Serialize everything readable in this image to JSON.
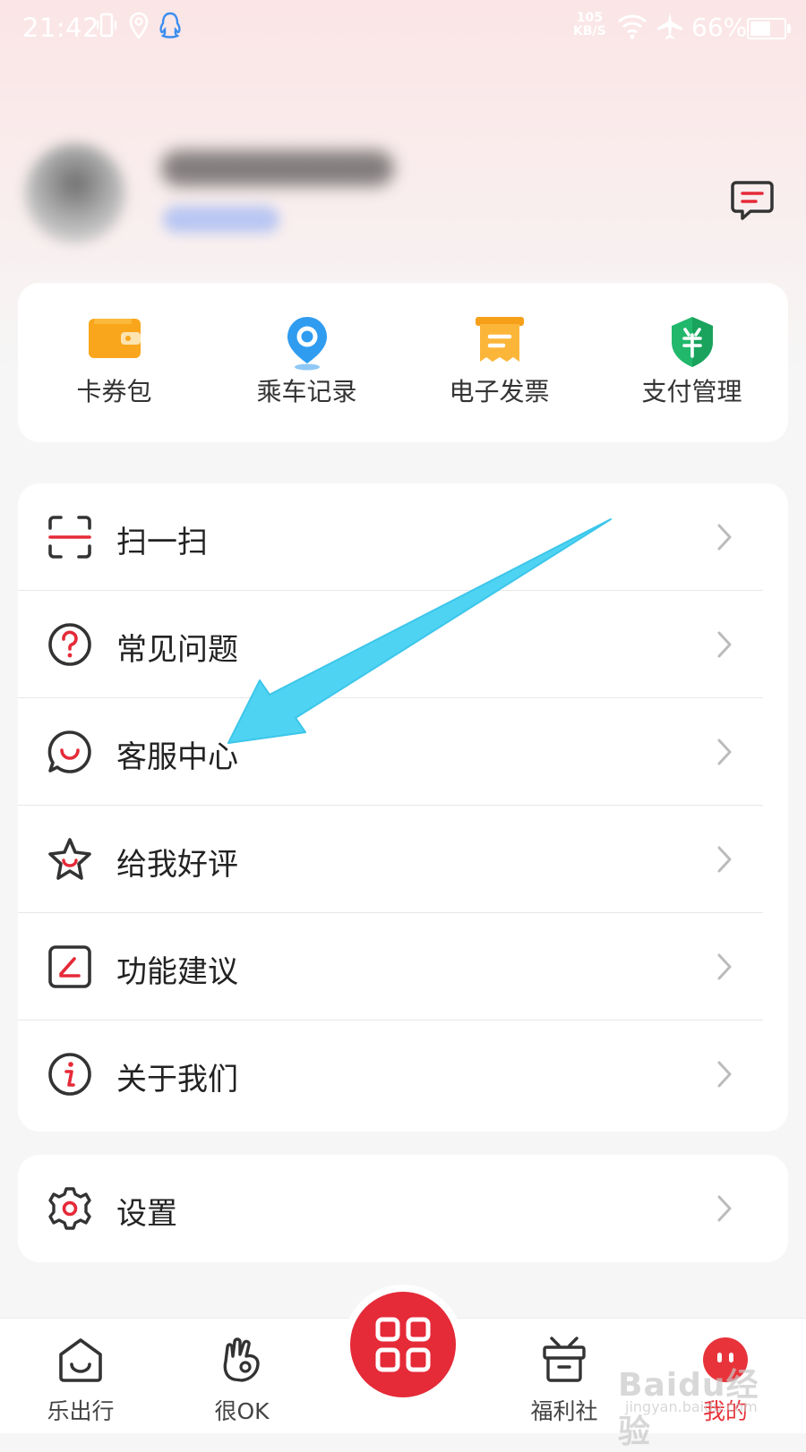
{
  "status_bar": {
    "time": "21:42",
    "net_speed_value": "105",
    "net_speed_unit": "KB/S",
    "battery_percent": "66%",
    "battery_level": 0.66
  },
  "quick_actions": [
    {
      "label": "卡券包",
      "icon": "wallet-icon"
    },
    {
      "label": "乘车记录",
      "icon": "location-pin-icon"
    },
    {
      "label": "电子发票",
      "icon": "invoice-icon"
    },
    {
      "label": "支付管理",
      "icon": "payment-shield-icon"
    }
  ],
  "menu": [
    {
      "label": "扫一扫",
      "icon": "scan-icon"
    },
    {
      "label": "常见问题",
      "icon": "question-icon"
    },
    {
      "label": "客服中心",
      "icon": "customer-service-icon"
    },
    {
      "label": "给我好评",
      "icon": "star-icon"
    },
    {
      "label": "功能建议",
      "icon": "edit-icon"
    },
    {
      "label": "关于我们",
      "icon": "info-icon"
    }
  ],
  "settings": {
    "label": "设置",
    "icon": "gear-icon"
  },
  "bottom_nav": [
    {
      "label": "乐出行",
      "icon": "home-smile-icon"
    },
    {
      "label": "很OK",
      "icon": "ok-hand-icon"
    },
    {
      "label": "福利社",
      "icon": "gift-box-icon"
    },
    {
      "label": "我的",
      "icon": "profile-face-icon",
      "active": true
    }
  ],
  "center_button": {
    "icon": "qr-code-icon"
  },
  "watermark": {
    "brand": "Baidu经验",
    "url": "jingyan.baidu.com"
  },
  "colors": {
    "accent": "#e52a38",
    "arrow": "#4fd3f2",
    "header_bg": "#fbe5e6"
  }
}
